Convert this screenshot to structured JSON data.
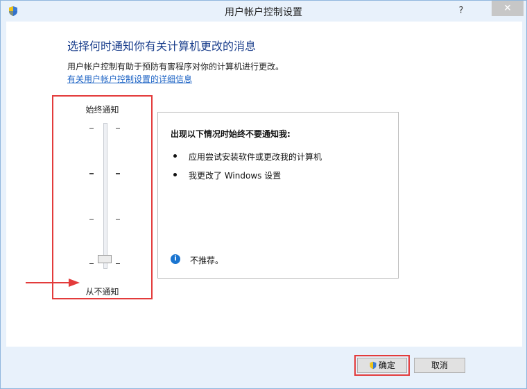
{
  "window": {
    "title": "用户帐户控制设置",
    "help_label": "?",
    "close_label": "✕"
  },
  "content": {
    "heading": "选择何时通知你有关计算机更改的消息",
    "description": "用户帐户控制有助于预防有害程序对你的计算机进行更改。",
    "detail_link": "有关用户帐户控制设置的详细信息"
  },
  "slider": {
    "top_label": "始终通知",
    "bottom_label": "从不通知",
    "levels": 4,
    "selected_level": 1
  },
  "info": {
    "title": "出现以下情况时始终不要通知我:",
    "bullets": [
      "应用尝试安装软件或更改我的计算机",
      "我更改了 Windows 设置"
    ],
    "recommendation": "不推荐。"
  },
  "buttons": {
    "ok_label": "确定",
    "cancel_label": "取消"
  },
  "colors": {
    "highlight": "#e33b3b",
    "heading": "#1a3e8c",
    "link": "#1b62c4"
  },
  "icons": {
    "title": "uac-shield-icon",
    "info": "info-icon",
    "ok": "uac-shield-icon"
  }
}
